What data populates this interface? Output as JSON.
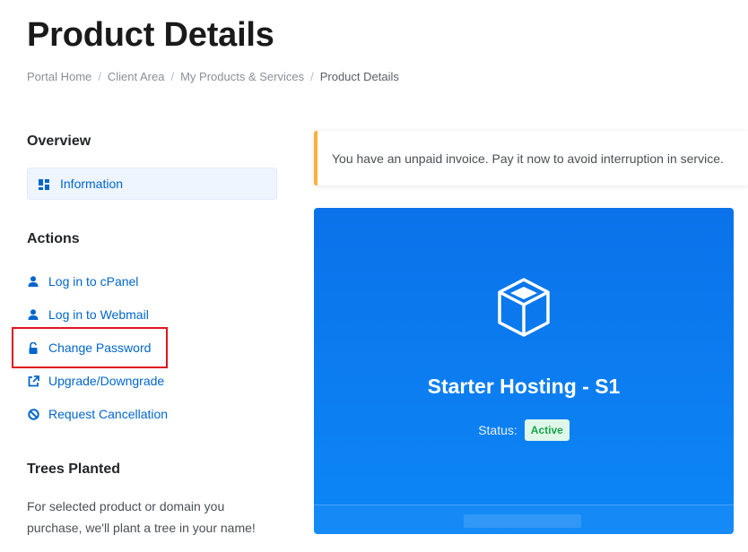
{
  "page": {
    "title": "Product Details"
  },
  "breadcrumb": {
    "items": [
      "Portal Home",
      "Client Area",
      "My Products & Services"
    ],
    "separator": "/",
    "active": "Product Details"
  },
  "sidebar": {
    "overview_heading": "Overview",
    "overview_item": {
      "label": "Information",
      "icon": "dashboard-icon"
    },
    "actions_heading": "Actions",
    "actions": [
      {
        "label": "Log in to cPanel",
        "icon": "user-icon"
      },
      {
        "label": "Log in to Webmail",
        "icon": "user-icon"
      },
      {
        "label": "Change Password",
        "icon": "unlock-icon"
      },
      {
        "label": "Upgrade/Downgrade",
        "icon": "external-link-icon"
      },
      {
        "label": "Request Cancellation",
        "icon": "ban-icon"
      }
    ],
    "trees_heading": "Trees Planted",
    "trees_text": "For selected product or domain you purchase, we'll plant a tree in your name!"
  },
  "alert": {
    "text": "You have an unpaid invoice. Pay it now to avoid interruption in service.",
    "accent_color": "#f9b23c"
  },
  "product": {
    "icon": "cube-icon",
    "name": "Starter Hosting - S1",
    "status_label": "Status:",
    "status_value": "Active",
    "card_color": "#0b7ff0"
  },
  "colors": {
    "link": "#0066cc",
    "highlight": "#e0141e",
    "status_active": "#17a34a"
  }
}
